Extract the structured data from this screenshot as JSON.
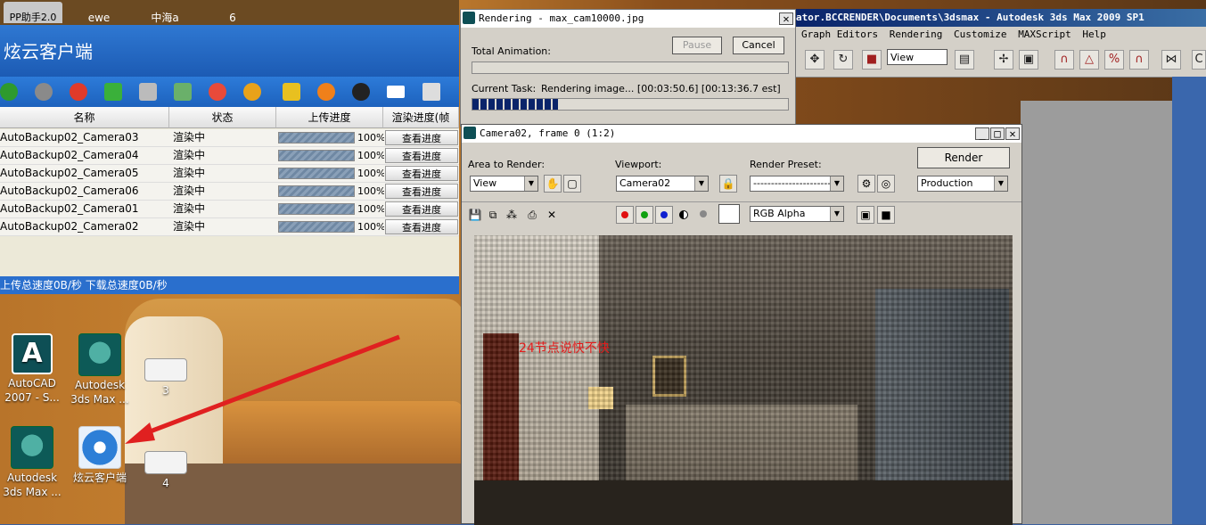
{
  "desktop": {
    "icons": [
      {
        "label": "AutoCAD\n2007 - S...",
        "icon": "autocad-icon"
      },
      {
        "label": "Autodesk\n3ds Max ...",
        "icon": "3dsmax-icon"
      },
      {
        "label": "3",
        "icon": "document-thumbnail-icon"
      },
      {
        "label": "Autodesk\n3ds Max ...",
        "icon": "3dsmax-icon"
      },
      {
        "label": "炫云客户端",
        "icon": "xuanyun-client-icon"
      },
      {
        "label": "4",
        "icon": "document-thumbnail-icon"
      }
    ]
  },
  "client": {
    "tabs": [
      "PP助手2.0",
      "ewe",
      "中海a",
      "6"
    ],
    "title": "炫云客户端",
    "columns": [
      "名称",
      "状态",
      "上传进度",
      "渲染进度(帧"
    ],
    "rows": [
      {
        "name": "AutoBackup02_Camera03",
        "status": "渲染中",
        "upload": "100%",
        "action": "查看进度",
        "progress": 1.0
      },
      {
        "name": "AutoBackup02_Camera04",
        "status": "渲染中",
        "upload": "100%",
        "action": "查看进度",
        "progress": 1.0
      },
      {
        "name": "AutoBackup02_Camera05",
        "status": "渲染中",
        "upload": "100%",
        "action": "查看进度",
        "progress": 1.0
      },
      {
        "name": "AutoBackup02_Camera06",
        "status": "渲染中",
        "upload": "100%",
        "action": "查看进度",
        "progress": 1.0
      },
      {
        "name": "AutoBackup02_Camera01",
        "status": "渲染中",
        "upload": "100%",
        "action": "查看进度",
        "progress": 1.0
      },
      {
        "name": "AutoBackup02_Camera02",
        "status": "渲染中",
        "upload": "100%",
        "action": "查看进度",
        "progress": 1.0
      }
    ],
    "status_bar": "上传总速度0B/秒   下载总速度0B/秒"
  },
  "max": {
    "title": "ator.BCCRENDER\\Documents\\3dsmax    - Autodesk 3ds Max  2009 SP1",
    "menu": [
      "Graph Editors",
      "Rendering",
      "Customize",
      "MAXScript",
      "Help"
    ],
    "toolbar_select": "View"
  },
  "rendering": {
    "title": "Rendering - max_cam10000.jpg",
    "pause_label": "Pause",
    "cancel_label": "Cancel",
    "total_animation_label": "Total Animation:",
    "current_task_label": "Current Task:",
    "current_task_value": "Rendering image... [00:03:50.6] [00:13:36.7 est]",
    "total_progress": 0.0,
    "task_progress": 0.27
  },
  "frame_window": {
    "title": "Camera02, frame 0 (1:2)",
    "area_label": "Area to Render:",
    "area_value": "View",
    "viewport_label": "Viewport:",
    "viewport_value": "Camera02",
    "preset_label": "Render Preset:",
    "preset_value": "-------------------------",
    "render_label": "Render",
    "production_value": "Production",
    "channel_value": "RGB Alpha",
    "overlay_text": "24节点说快不快"
  },
  "colors": {
    "client_blue": "#1d62bd",
    "max_title_blue": "#0a246a",
    "overlay_red": "#e21b1b"
  }
}
